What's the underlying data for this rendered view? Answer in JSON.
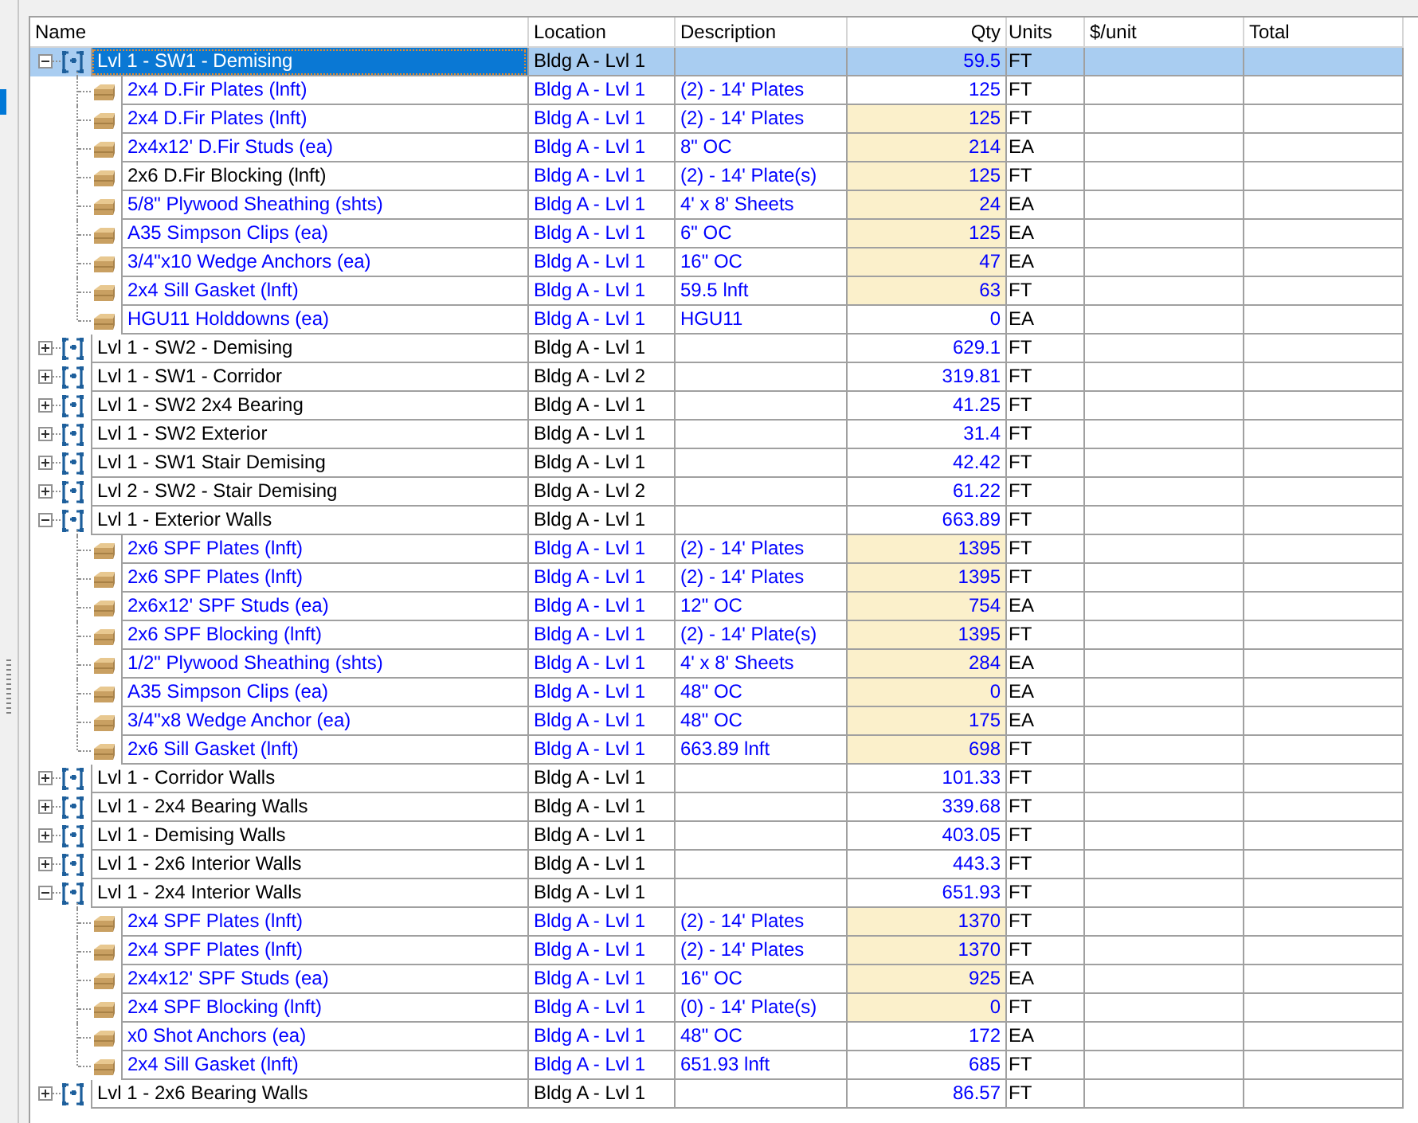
{
  "table": {
    "columns": [
      "Name",
      "Location",
      "Description",
      "Qty",
      "Units",
      "$/unit",
      "Total"
    ],
    "rows": [
      {
        "name": "Lvl 1 - SW1 - Demising",
        "location": "Bldg A - Lvl 1",
        "qty": "59.5",
        "units": "FT",
        "expanded": true,
        "selected": true,
        "children": [
          {
            "name": "2x4 D.Fir Plates (lnft)",
            "color": "#0000ff",
            "location": "Bldg A - Lvl 1",
            "description": "(2) - 14' Plates",
            "qty": "125",
            "qty_edited": false,
            "units": "FT"
          },
          {
            "name": "2x4 D.Fir Plates (lnft)",
            "color": "#0000ff",
            "location": "Bldg A - Lvl 1",
            "description": "(2) - 14' Plates",
            "qty": "125",
            "qty_edited": true,
            "units": "FT"
          },
          {
            "name": "2x4x12' D.Fir Studs (ea)",
            "color": "#0000ff",
            "location": "Bldg A - Lvl 1",
            "description": "8\" OC",
            "qty": "214",
            "qty_edited": true,
            "units": "EA"
          },
          {
            "name": "2x6 D.Fir Blocking (lnft)",
            "color": "#000000",
            "location": "Bldg A - Lvl 1",
            "description": "(2) - 14' Plate(s)",
            "qty": "125",
            "qty_edited": true,
            "units": "FT"
          },
          {
            "name": "5/8\" Plywood Sheathing (shts)",
            "color": "#0000ff",
            "location": "Bldg A - Lvl 1",
            "description": "4' x 8' Sheets",
            "qty": "24",
            "qty_edited": true,
            "units": "EA"
          },
          {
            "name": "A35 Simpson Clips (ea)",
            "color": "#0000ff",
            "location": "Bldg A - Lvl 1",
            "description": "6\" OC",
            "qty": "125",
            "qty_edited": true,
            "units": "EA"
          },
          {
            "name": "3/4\"x10 Wedge Anchors (ea)",
            "color": "#0000ff",
            "location": "Bldg A - Lvl 1",
            "description": "16\" OC",
            "qty": "47",
            "qty_edited": true,
            "units": "EA"
          },
          {
            "name": "2x4 Sill Gasket (lnft)",
            "color": "#0000ff",
            "location": "Bldg A - Lvl 1",
            "description": "59.5 lnft",
            "qty": "63",
            "qty_edited": true,
            "units": "FT"
          },
          {
            "name": "HGU11 Holddowns (ea)",
            "color": "#0000ff",
            "location": "Bldg A - Lvl 1",
            "description": "HGU11",
            "qty": "0",
            "qty_edited": false,
            "units": "EA"
          }
        ]
      },
      {
        "name": "Lvl 1 - SW2 - Demising",
        "location": "Bldg A - Lvl 1",
        "qty": "629.1",
        "units": "FT",
        "expanded": false,
        "selected": false
      },
      {
        "name": "Lvl 1 - SW1 - Corridor",
        "location": "Bldg A - Lvl 2",
        "qty": "319.81",
        "units": "FT",
        "expanded": false,
        "selected": false
      },
      {
        "name": "Lvl 1 - SW2 2x4 Bearing",
        "location": "Bldg A - Lvl 1",
        "qty": "41.25",
        "units": "FT",
        "expanded": false,
        "selected": false
      },
      {
        "name": "Lvl 1 - SW2 Exterior",
        "location": "Bldg A - Lvl 1",
        "qty": "31.4",
        "units": "FT",
        "expanded": false,
        "selected": false
      },
      {
        "name": "Lvl 1 - SW1 Stair Demising",
        "location": "Bldg A - Lvl 1",
        "qty": "42.42",
        "units": "FT",
        "expanded": false,
        "selected": false
      },
      {
        "name": "Lvl 2 - SW2 - Stair Demising",
        "location": "Bldg A - Lvl 2",
        "qty": "61.22",
        "units": "FT",
        "expanded": false,
        "selected": false
      },
      {
        "name": "Lvl 1 - Exterior Walls",
        "location": "Bldg A - Lvl 1",
        "qty": "663.89",
        "units": "FT",
        "expanded": true,
        "selected": false,
        "children": [
          {
            "name": "2x6 SPF Plates (lnft)",
            "color": "#0000ff",
            "location": "Bldg A - Lvl 1",
            "description": "(2) - 14' Plates",
            "qty": "1395",
            "qty_edited": true,
            "units": "FT"
          },
          {
            "name": "2x6 SPF Plates (lnft)",
            "color": "#0000ff",
            "location": "Bldg A - Lvl 1",
            "description": "(2) - 14' Plates",
            "qty": "1395",
            "qty_edited": true,
            "units": "FT"
          },
          {
            "name": "2x6x12' SPF Studs (ea)",
            "color": "#0000ff",
            "location": "Bldg A - Lvl 1",
            "description": "12\" OC",
            "qty": "754",
            "qty_edited": true,
            "units": "EA"
          },
          {
            "name": "2x6 SPF Blocking (lnft)",
            "color": "#0000ff",
            "location": "Bldg A - Lvl 1",
            "description": "(2) - 14' Plate(s)",
            "qty": "1395",
            "qty_edited": true,
            "units": "FT"
          },
          {
            "name": "1/2\" Plywood Sheathing (shts)",
            "color": "#0000ff",
            "location": "Bldg A - Lvl 1",
            "description": "4' x 8' Sheets",
            "qty": "284",
            "qty_edited": true,
            "units": "EA"
          },
          {
            "name": "A35 Simpson Clips (ea)",
            "color": "#0000ff",
            "location": "Bldg A - Lvl 1",
            "description": "48\" OC",
            "qty": "0",
            "qty_edited": true,
            "units": "EA"
          },
          {
            "name": "3/4\"x8 Wedge Anchor (ea)",
            "color": "#0000ff",
            "location": "Bldg A - Lvl 1",
            "description": "48\" OC",
            "qty": "175",
            "qty_edited": true,
            "units": "EA"
          },
          {
            "name": "2x6 Sill Gasket (lnft)",
            "color": "#0000ff",
            "location": "Bldg A - Lvl 1",
            "description": "663.89 lnft",
            "qty": "698",
            "qty_edited": true,
            "units": "FT"
          }
        ]
      },
      {
        "name": "Lvl 1 - Corridor Walls",
        "location": "Bldg A - Lvl 1",
        "qty": "101.33",
        "units": "FT",
        "expanded": false,
        "selected": false
      },
      {
        "name": "Lvl 1 - 2x4 Bearing Walls",
        "location": "Bldg A - Lvl 1",
        "qty": "339.68",
        "units": "FT",
        "expanded": false,
        "selected": false
      },
      {
        "name": "Lvl 1 - Demising Walls",
        "location": "Bldg A - Lvl 1",
        "qty": "403.05",
        "units": "FT",
        "expanded": false,
        "selected": false
      },
      {
        "name": "Lvl 1 - 2x6 Interior Walls",
        "location": "Bldg A - Lvl 1",
        "qty": "443.3",
        "units": "FT",
        "expanded": false,
        "selected": false
      },
      {
        "name": "Lvl 1 - 2x4 Interior Walls",
        "location": "Bldg A - Lvl 1",
        "qty": "651.93",
        "units": "FT",
        "expanded": true,
        "selected": false,
        "children": [
          {
            "name": "2x4 SPF Plates (lnft)",
            "color": "#0000ff",
            "location": "Bldg A - Lvl 1",
            "description": "(2) - 14' Plates",
            "qty": "1370",
            "qty_edited": true,
            "units": "FT"
          },
          {
            "name": "2x4 SPF Plates (lnft)",
            "color": "#0000ff",
            "location": "Bldg A - Lvl 1",
            "description": "(2) - 14' Plates",
            "qty": "1370",
            "qty_edited": true,
            "units": "FT"
          },
          {
            "name": "2x4x12' SPF Studs (ea)",
            "color": "#0000ff",
            "location": "Bldg A - Lvl 1",
            "description": "16\" OC",
            "qty": "925",
            "qty_edited": true,
            "units": "EA"
          },
          {
            "name": "2x4 SPF Blocking (lnft)",
            "color": "#0000ff",
            "location": "Bldg A - Lvl 1",
            "description": "(0) - 14' Plate(s)",
            "qty": "0",
            "qty_edited": true,
            "units": "FT"
          },
          {
            "name": "x0 Shot Anchors (ea)",
            "color": "#0000ff",
            "location": "Bldg A - Lvl 1",
            "description": "48\" OC",
            "qty": "172",
            "qty_edited": false,
            "units": "EA"
          },
          {
            "name": "2x4 Sill Gasket (lnft)",
            "color": "#0000ff",
            "location": "Bldg A - Lvl 1",
            "description": "651.93 lnft",
            "qty": "685",
            "qty_edited": false,
            "units": "FT"
          }
        ]
      },
      {
        "name": "Lvl 1 - 2x6 Bearing Walls",
        "location": "Bldg A - Lvl 1",
        "qty": "86.57",
        "units": "FT",
        "expanded": false,
        "selected": false
      }
    ]
  }
}
